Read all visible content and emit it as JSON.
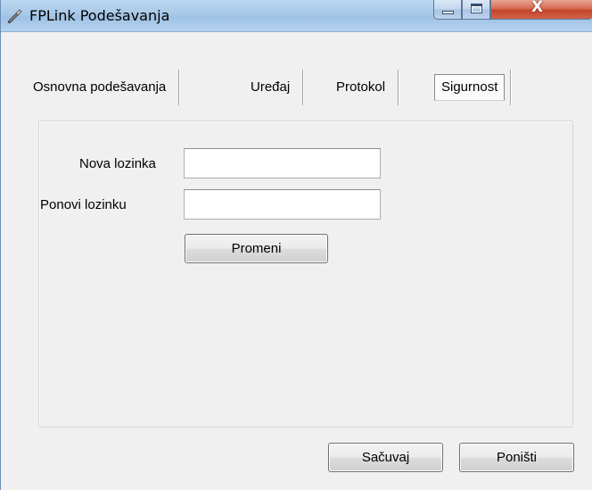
{
  "window": {
    "title": "FPLink Podešavanja",
    "controls": {
      "close_glyph": "X"
    }
  },
  "tabs": [
    {
      "label": "Osnovna podešavanja",
      "selected": false
    },
    {
      "label": "Uređaj",
      "selected": false
    },
    {
      "label": "Protokol",
      "selected": false
    },
    {
      "label": "Sigurnost",
      "selected": true
    }
  ],
  "form": {
    "new_password_label": "Nova lozinka",
    "new_password_value": "",
    "repeat_password_label": "Ponovi lozinku",
    "repeat_password_value": "",
    "change_button": "Promeni"
  },
  "footer": {
    "save_button": "Sačuvaj",
    "cancel_button": "Poništi"
  },
  "colors": {
    "titlebar": "#a9c9e9",
    "close_button": "#c4442a",
    "window_bg": "#f0f0f0"
  },
  "icons": [
    "app-icon",
    "minimize-icon",
    "maximize-icon",
    "close-icon"
  ]
}
